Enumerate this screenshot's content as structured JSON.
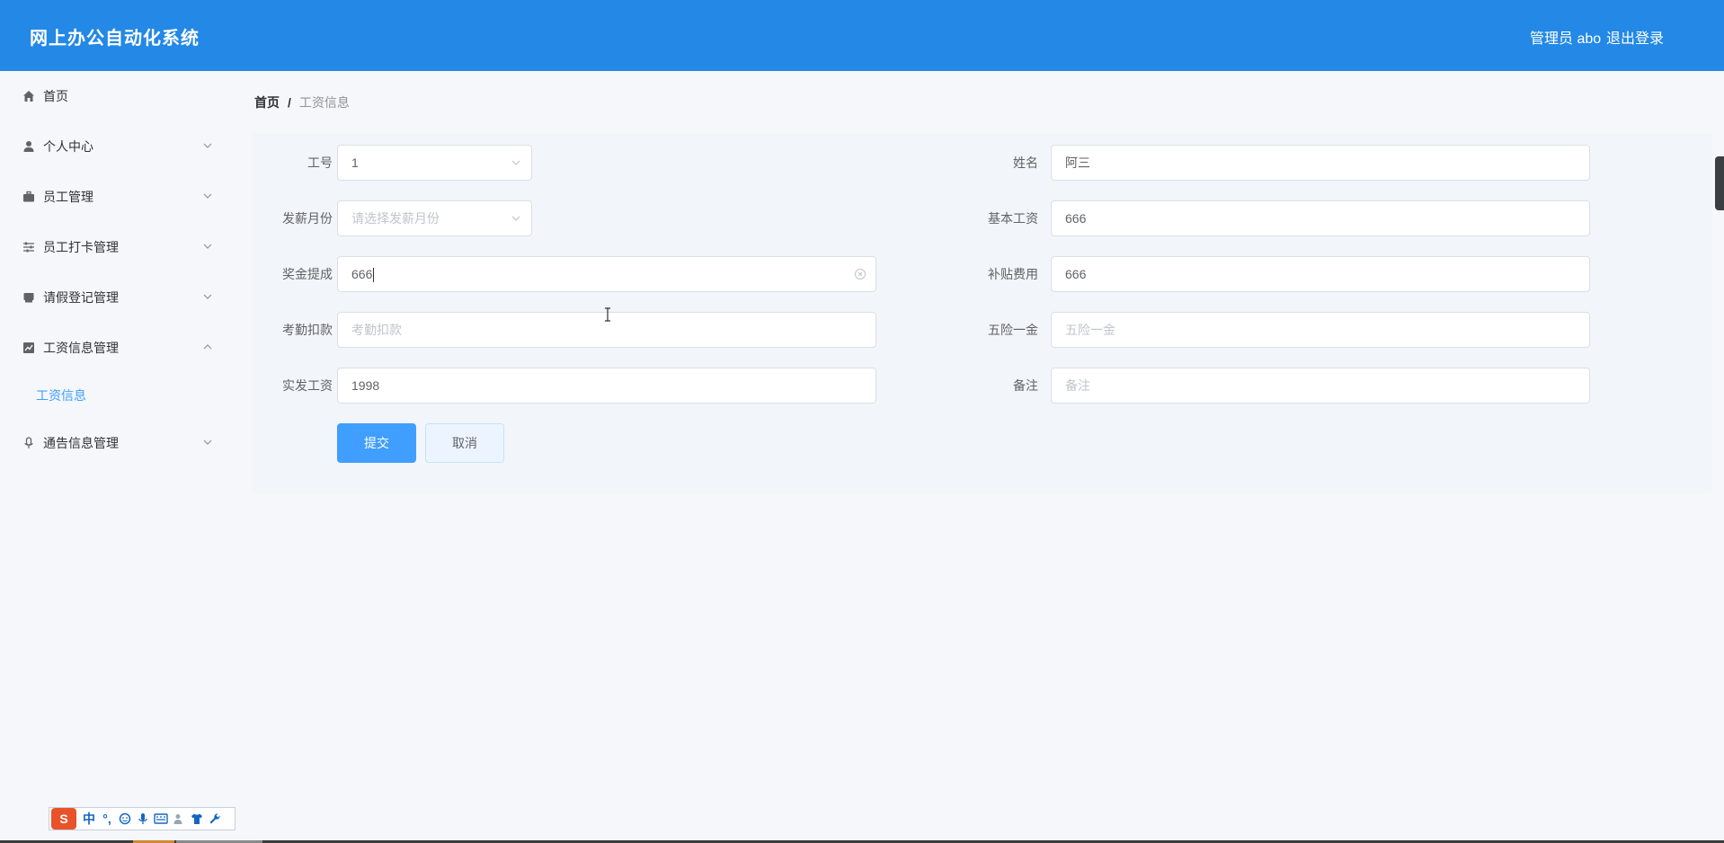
{
  "header": {
    "title": "网上办公自动化系统",
    "user": "管理员 abo",
    "logout": "退出登录"
  },
  "sidebar": {
    "items": [
      {
        "label": "首页",
        "icon": "home-icon"
      },
      {
        "label": "个人中心",
        "icon": "user-icon"
      },
      {
        "label": "员工管理",
        "icon": "briefcase-icon"
      },
      {
        "label": "员工打卡管理",
        "icon": "sliders-icon"
      },
      {
        "label": "请假登记管理",
        "icon": "printer-icon"
      },
      {
        "label": "工资信息管理",
        "icon": "chart-icon"
      },
      {
        "label": "通告信息管理",
        "icon": "microphone-icon"
      }
    ],
    "sub_item": "工资信息"
  },
  "breadcrumb": {
    "home": "首页",
    "separator": "/",
    "current": "工资信息"
  },
  "form": {
    "employee_id": {
      "label": "工号",
      "value": "1"
    },
    "name": {
      "label": "姓名",
      "value": "阿三"
    },
    "pay_month": {
      "label": "发薪月份",
      "placeholder": "请选择发薪月份"
    },
    "base_salary": {
      "label": "基本工资",
      "value": "666"
    },
    "bonus": {
      "label": "奖金提成",
      "value": "666"
    },
    "allowance": {
      "label": "补贴费用",
      "value": "666"
    },
    "attendance_deduction": {
      "label": "考勤扣款",
      "placeholder": "考勤扣款"
    },
    "insurance": {
      "label": "五险一金",
      "placeholder": "五险一金"
    },
    "actual_salary": {
      "label": "实发工资",
      "value": "1998"
    },
    "remarks": {
      "label": "备注",
      "placeholder": "备注"
    },
    "submit": "提交",
    "cancel": "取消"
  },
  "ime": {
    "logo": "S",
    "mode": "中",
    "punct": "°,"
  },
  "colors": {
    "header": "#2388e6",
    "primary": "#409eff"
  }
}
